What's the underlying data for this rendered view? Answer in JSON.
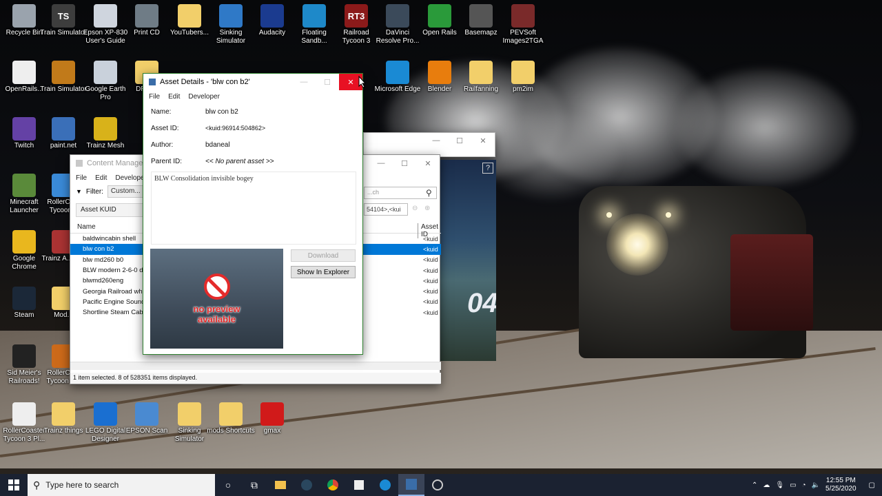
{
  "desktop_icons": [
    {
      "label": "Recycle Bin",
      "icon": "recycle-bin-icon",
      "color": "#9aa3ad"
    },
    {
      "label": "Train Simulator",
      "icon": "ts-icon",
      "color": "#3d3d3d",
      "glyph": "TS"
    },
    {
      "label": "Epson XP-830 User's Guide",
      "icon": "epson-guide-icon",
      "color": "#cfd5de"
    },
    {
      "label": "Print CD",
      "icon": "print-cd-icon",
      "color": "#6f7c86"
    },
    {
      "label": "YouTubers...",
      "icon": "folder-icon",
      "color": "#f2cf6a"
    },
    {
      "label": "Sinking Simulator",
      "icon": "sinking-sim-icon",
      "color": "#2f79c7"
    },
    {
      "label": "Audacity",
      "icon": "audacity-icon",
      "color": "#1b3b8f"
    },
    {
      "label": "Floating Sandb...",
      "icon": "floating-sandbox-icon",
      "color": "#1e89c9"
    },
    {
      "label": "Railroad Tycoon 3",
      "icon": "rt3-icon",
      "color": "#8b1a1a",
      "glyph": "RT3"
    },
    {
      "label": "DaVinci Resolve Pro...",
      "icon": "davinci-icon",
      "color": "#3b4a5a"
    },
    {
      "label": "Open Rails",
      "icon": "openrails-icon",
      "color": "#2a9a3a"
    },
    {
      "label": "Basemapz",
      "icon": "basemapz-icon",
      "color": "#555"
    },
    {
      "label": "PEVSoft Images2TGA",
      "icon": "pevsoft-icon",
      "color": "#7a2a2a"
    },
    {
      "label": "OpenRails...",
      "icon": "document-icon",
      "color": "#eeeeee"
    },
    {
      "label": "Train Simulator",
      "icon": "trainsim-2-icon",
      "color": "#c17a1a"
    },
    {
      "label": "Google Earth Pro",
      "icon": "google-earth-icon",
      "color": "#c9d1db"
    },
    {
      "label": "DRGW",
      "icon": "drgw-folder-icon",
      "color": "#f2cf6a"
    },
    {
      "label": "Microsoft Edge",
      "icon": "edge-icon",
      "color": "#1a8ad4"
    },
    {
      "label": "Blender",
      "icon": "blender-icon",
      "color": "#e87d0d"
    },
    {
      "label": "Railfanning",
      "icon": "railfanning-icon",
      "color": "#f2cf6a"
    },
    {
      "label": "pm2im",
      "icon": "folder-icon",
      "color": "#f2cf6a"
    },
    {
      "label": "Twitch",
      "icon": "twitch-icon",
      "color": "#6441a5"
    },
    {
      "label": "paint.net",
      "icon": "paintnet-icon",
      "color": "#3a6fb8"
    },
    {
      "label": "Trainz Mesh",
      "icon": "trainz-mesh-icon",
      "color": "#d8b21a"
    },
    {
      "label": "Minecraft Launcher",
      "icon": "minecraft-icon",
      "color": "#5a8a3a"
    },
    {
      "label": "RollerCo... Tycoon...",
      "icon": "rct-icon",
      "color": "#3a8ad8"
    },
    {
      "label": "Google Chrome",
      "icon": "chrome-icon",
      "color": "#e9b71e"
    },
    {
      "label": "Trainz A... Era",
      "icon": "trainz-era-icon",
      "color": "#a33"
    },
    {
      "label": "Steam",
      "icon": "steam-icon",
      "color": "#1b2838"
    },
    {
      "label": "Mod...",
      "icon": "mod-folder-icon",
      "color": "#f2cf6a"
    },
    {
      "label": "Sid Meier's Railroads!",
      "icon": "sid-meier-icon",
      "color": "#222"
    },
    {
      "label": "RollerCo... Tycoon 2...",
      "icon": "rct2-icon",
      "color": "#cc6a1a"
    },
    {
      "label": "RollerCoaster Tycoon 3 Pl...",
      "icon": "rct3-doc-icon",
      "color": "#eeeeee"
    },
    {
      "label": "Trainz things",
      "icon": "folder-icon",
      "color": "#f2cf6a"
    },
    {
      "label": "LEGO Digital Designer",
      "icon": "lego-icon",
      "color": "#1a6fd1"
    },
    {
      "label": "EPSON Scan",
      "icon": "epson-scan-icon",
      "color": "#4a8ad1"
    },
    {
      "label": "Sinking Simulator",
      "icon": "folder-icon",
      "color": "#f2cf6a"
    },
    {
      "label": "mods Shortcuts",
      "icon": "folder-icon",
      "color": "#f2cf6a"
    },
    {
      "label": "gmax",
      "icon": "gmax-icon",
      "color": "#d11a1a"
    }
  ],
  "content_manager": {
    "title": "Content Manager",
    "menu": [
      "File",
      "Edit",
      "Developer"
    ],
    "filter_label": "Filter:",
    "filter_value": "Custom...",
    "search_placeholder": "...ch",
    "kuid_filter": "54104>,<kui",
    "left_header": "Asset KUID",
    "col_name": "Name",
    "col_kuid": "Asset ID",
    "rows": [
      {
        "name": "baldwincabin shell",
        "kuid": "<kuid"
      },
      {
        "name": "blw con b2",
        "kuid": "<kuid",
        "selected": true
      },
      {
        "name": "blw md260 b0",
        "kuid": "<kuid"
      },
      {
        "name": "BLW modern 2-6-0 d...",
        "kuid": "<kuid"
      },
      {
        "name": "blwmd260eng",
        "kuid": "<kuid"
      },
      {
        "name": "Georgia Railroad whi...",
        "kuid": "<kuid"
      },
      {
        "name": "Pacific Engine Sound...",
        "kuid": "<kuid"
      },
      {
        "name": "Shortline Steam Cab...",
        "kuid": "<kuid"
      }
    ],
    "status": "1 item selected. 8 of 528351 items displayed."
  },
  "asset_details": {
    "title": "Asset Details - 'blw con b2'",
    "menu": [
      "File",
      "Edit",
      "Developer"
    ],
    "name_label": "Name:",
    "name_value": "blw con b2",
    "id_label": "Asset ID:",
    "id_value": "<kuid:96914:504862>",
    "author_label": "Author:",
    "author_value": "bdaneal",
    "parent_label": "Parent ID:",
    "parent_value": "<< No parent asset >>",
    "description": "BLW Consolidation invisible bogey",
    "preview_text_1": "no preview",
    "preview_text_2": "available",
    "download_label": "Download",
    "explorer_label": "Show In Explorer"
  },
  "promo": {
    "text": "04"
  },
  "taskbar": {
    "search_placeholder": "Type here to search",
    "time": "12:55 PM",
    "date": "5/25/2020"
  }
}
